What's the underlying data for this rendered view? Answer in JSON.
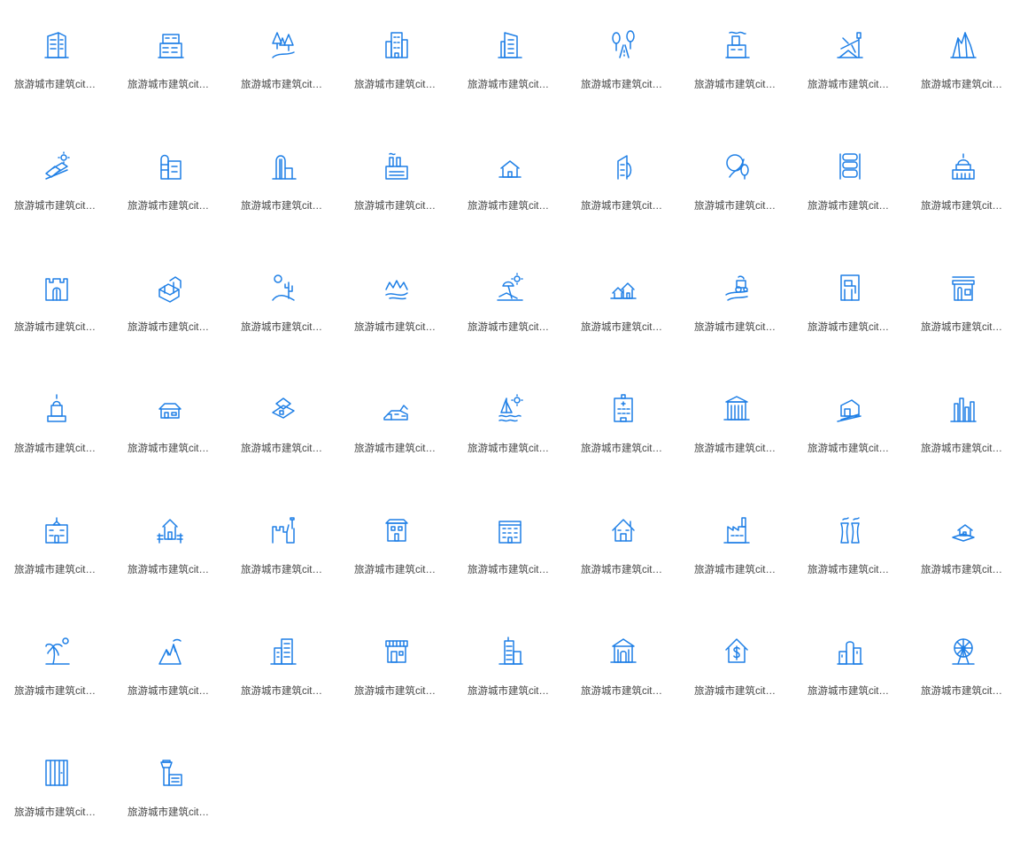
{
  "accent_color": "#1e7fe6",
  "text_color": "#444444",
  "icons": [
    {
      "name": "office-building-icon",
      "label": "旅游城市建筑citymetro"
    },
    {
      "name": "shop-building-icon",
      "label": "旅游城市建筑citymetro"
    },
    {
      "name": "forest-trees-icon",
      "label": "旅游城市建筑citymetro"
    },
    {
      "name": "city-buildings-icon",
      "label": "旅游城市建筑citymetro"
    },
    {
      "name": "skyscraper-icon",
      "label": "旅游城市建筑citymetro"
    },
    {
      "name": "tree-road-icon",
      "label": "旅游城市建筑citymetro"
    },
    {
      "name": "factory-smoke-icon",
      "label": "旅游城市建筑citymetro"
    },
    {
      "name": "airport-plane-icon",
      "label": "旅游城市建筑citymetro"
    },
    {
      "name": "mountain-rocks-icon",
      "label": "旅游城市建筑citymetro"
    },
    {
      "name": "solar-field-icon",
      "label": "旅游城市建筑citymetro"
    },
    {
      "name": "silo-building-icon",
      "label": "旅游城市建筑citymetro"
    },
    {
      "name": "modern-tower-icon",
      "label": "旅游城市建筑citymetro"
    },
    {
      "name": "industrial-plant-icon",
      "label": "旅游城市建筑citymetro"
    },
    {
      "name": "modern-house-icon",
      "label": "旅游城市建筑citymetro"
    },
    {
      "name": "curved-tower-icon",
      "label": "旅游城市建筑citymetro"
    },
    {
      "name": "park-path-icon",
      "label": "旅游城市建筑citymetro"
    },
    {
      "name": "stacked-tanks-icon",
      "label": "旅游城市建筑citymetro"
    },
    {
      "name": "capitol-dome-icon",
      "label": "旅游城市建筑citymetro"
    },
    {
      "name": "castle-gate-icon",
      "label": "旅游城市建筑citymetro"
    },
    {
      "name": "isometric-block-icon",
      "label": "旅游城市建筑citymetro"
    },
    {
      "name": "desert-cactus-icon",
      "label": "旅游城市建筑citymetro"
    },
    {
      "name": "lake-mountains-icon",
      "label": "旅游城市建筑citymetro"
    },
    {
      "name": "beach-umbrella-icon",
      "label": "旅游城市建筑citymetro"
    },
    {
      "name": "two-houses-icon",
      "label": "旅游城市建筑citymetro"
    },
    {
      "name": "farm-tractor-icon",
      "label": "旅游城市建筑citymetro"
    },
    {
      "name": "gas-station-icon",
      "label": "旅游城市建筑citymetro"
    },
    {
      "name": "storefront-icon",
      "label": "旅游城市建筑citymetro"
    },
    {
      "name": "temple-stupa-icon",
      "label": "旅游城市建筑citymetro"
    },
    {
      "name": "bungalow-icon",
      "label": "旅游城市建筑citymetro"
    },
    {
      "name": "cottage-icon",
      "label": "旅游城市建筑citymetro"
    },
    {
      "name": "long-house-icon",
      "label": "旅游城市建筑citymetro"
    },
    {
      "name": "sailboat-sea-icon",
      "label": "旅游城市建筑citymetro"
    },
    {
      "name": "hospital-building-icon",
      "label": "旅游城市建筑citymetro"
    },
    {
      "name": "columns-hall-icon",
      "label": "旅游城市建筑citymetro"
    },
    {
      "name": "modern-villa-icon",
      "label": "旅游城市建筑citymetro"
    },
    {
      "name": "city-skyline-icon",
      "label": "旅游城市建筑citymetro"
    },
    {
      "name": "school-building-icon",
      "label": "旅游城市建筑citymetro"
    },
    {
      "name": "fenced-house-icon",
      "label": "旅游城市建筑citymetro"
    },
    {
      "name": "fortress-icon",
      "label": "旅游城市建筑citymetro"
    },
    {
      "name": "townhouse-icon",
      "label": "旅游城市建筑citymetro"
    },
    {
      "name": "apartment-block-icon",
      "label": "旅游城市建筑citymetro"
    },
    {
      "name": "home-icon",
      "label": "旅游城市建筑citymetro"
    },
    {
      "name": "factory-icon",
      "label": "旅游城市建筑citymetro"
    },
    {
      "name": "cooling-towers-icon",
      "label": "旅游城市建筑citymetro"
    },
    {
      "name": "island-house-icon",
      "label": "旅游城市建筑citymetro"
    },
    {
      "name": "palm-tree-icon",
      "label": "旅游城市建筑citymetro"
    },
    {
      "name": "volcano-mountain-icon",
      "label": "旅游城市建筑citymetro"
    },
    {
      "name": "office-tower-icon",
      "label": "旅游城市建筑citymetro"
    },
    {
      "name": "awning-shop-icon",
      "label": "旅游城市建筑citymetro"
    },
    {
      "name": "tall-hotel-icon",
      "label": "旅游城市建筑citymetro"
    },
    {
      "name": "bank-building-icon",
      "label": "旅游城市建筑citymetro"
    },
    {
      "name": "real-estate-dollar-icon",
      "label": "旅游城市建筑citymetro"
    },
    {
      "name": "industrial-complex-icon",
      "label": "旅游城市建筑citymetro"
    },
    {
      "name": "ferris-wheel-icon",
      "label": "旅游城市建筑citymetro"
    },
    {
      "name": "wardrobe-gate-icon",
      "label": "旅游城市建筑citymetro"
    },
    {
      "name": "control-tower-icon",
      "label": "旅游城市建筑citymetro"
    }
  ]
}
